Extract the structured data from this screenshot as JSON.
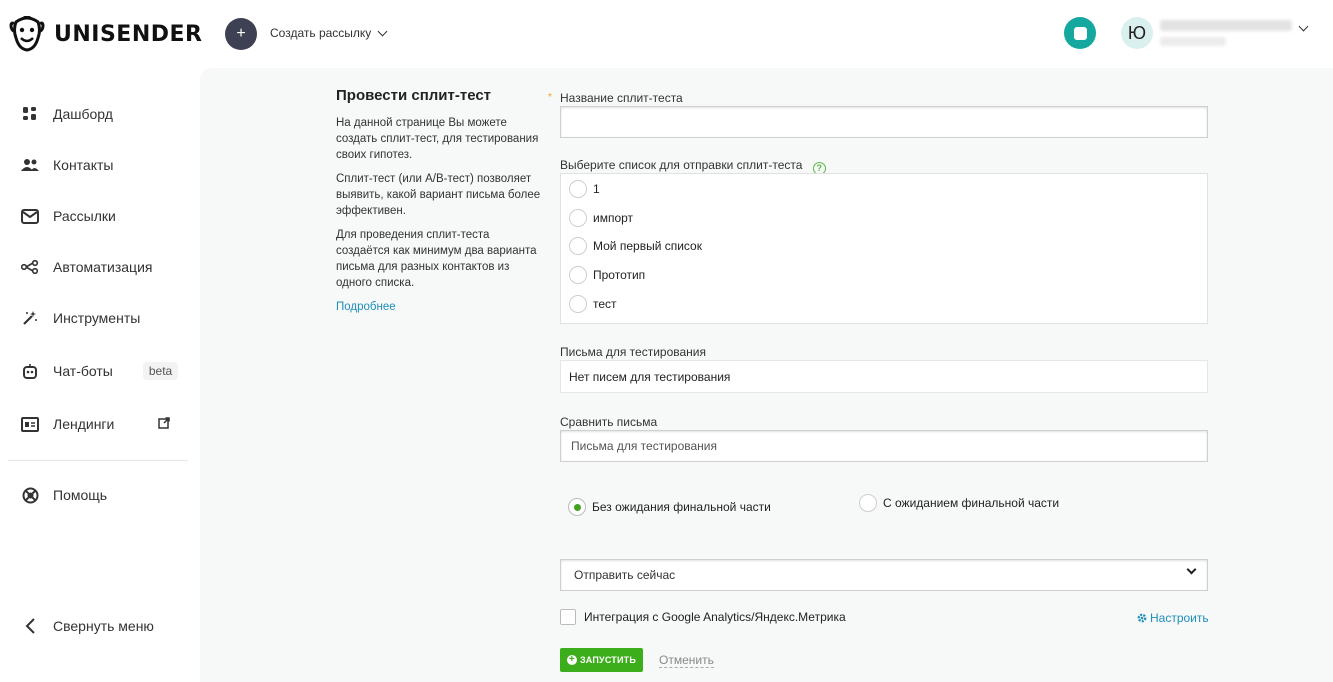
{
  "header": {
    "brand": "UNISENDER",
    "create_plus": "+",
    "create_label": "Создать рассылку",
    "avatar_letter": "Ю"
  },
  "sidebar": {
    "items": [
      {
        "label": "Дашборд",
        "icon": "dashboard-icon"
      },
      {
        "label": "Контакты",
        "icon": "contacts-icon"
      },
      {
        "label": "Рассылки",
        "icon": "mail-icon"
      },
      {
        "label": "Автоматизация",
        "icon": "automation-icon"
      },
      {
        "label": "Инструменты",
        "icon": "magic-wand-icon"
      },
      {
        "label": "Чат-боты",
        "icon": "robot-icon",
        "badge": "beta"
      },
      {
        "label": "Лендинги",
        "icon": "landing-icon",
        "external": "external-link-icon"
      },
      {
        "label": "Помощь",
        "icon": "help-icon"
      }
    ],
    "collapse_label": "Свернуть меню"
  },
  "info": {
    "title": "Провести сплит-тест",
    "p1": "На данной странице Вы можете создать сплит-тест, для тестирования своих гипотез.",
    "p2": "Сплит-тест (или A/B-тест) позволяет выявить, какой вариант письма более эффективен.",
    "p3": "Для проведения сплит-теста создаётся как минимум два варианта письма для разных контактов из одного списка.",
    "more_link": "Подробнее"
  },
  "form": {
    "name_label": "Название сплит-теста",
    "required_mark": "*",
    "name_value": "",
    "list_label": "Выберите список для отправки сплит-теста",
    "list_help": "?",
    "lists": [
      "1",
      "импорт",
      "Мой первый список",
      "Прототип",
      "тест"
    ],
    "letters_label": "Письма для тестирования",
    "letters_value": "Нет писем для тестирования",
    "compare_label": "Сравнить письма",
    "compare_placeholder": "Письма для тестирования",
    "mode_without": "Без ожидания финальной части",
    "mode_with": "С ожиданием финальной части",
    "mode_selected": "without",
    "send_select": "Отправить сейчас",
    "integration_label": "Интеграция с Google Analytics/Яндекс.Метрика",
    "integration_checked": false,
    "configure_link": "Настроить",
    "run_button": "ЗАПУСТИТЬ",
    "cancel_link": "Отменить"
  },
  "colors": {
    "accent_green": "#3cae1c",
    "link_blue": "#1f8fb8",
    "teal": "#14a89e"
  }
}
